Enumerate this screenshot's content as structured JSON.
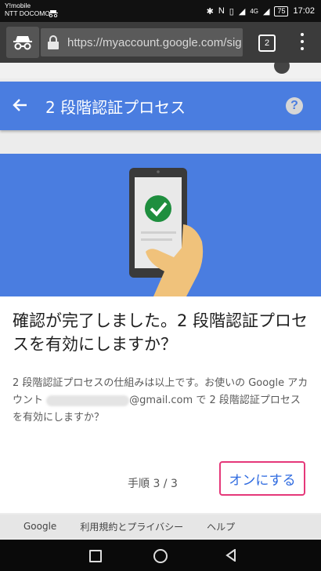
{
  "status_bar": {
    "carrier_line1": "Y!mobile",
    "carrier_line2": "NTT DOCOMO",
    "signal_label": "4G",
    "battery": "75",
    "time": "17:02"
  },
  "browser": {
    "url": "https://myaccount.google.com/sig",
    "tab_count": "2"
  },
  "header": {
    "title": "2 段階認証プロセス",
    "help_label": "?"
  },
  "dialog": {
    "title": "確認が完了しました。2 段階認証プロセスを有効にしますか？",
    "body_part1": "2 段階認証プロセスの仕組みは以上です。お使いの Google アカウント",
    "body_email_domain": "@gmail.com",
    "body_part2": "で 2 段階認証プロセスを有効にしますか？",
    "step": "手順 3 / 3",
    "confirm_button": "オンにする"
  },
  "footer": {
    "links": [
      "Google",
      "利用規約とプライバシー",
      "ヘルプ"
    ]
  },
  "colors": {
    "accent_blue": "#4a7de0",
    "highlight_pink": "#e53879",
    "check_green": "#1e8e3e"
  }
}
